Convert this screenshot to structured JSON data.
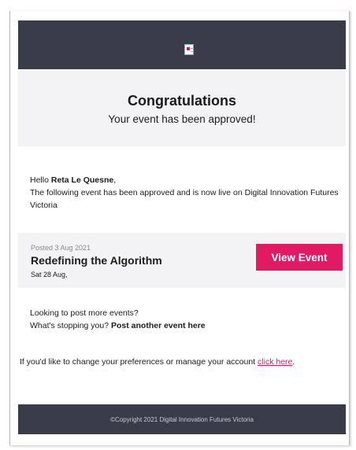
{
  "hero": {
    "title": "Congratulations",
    "subtitle": "Your event has been approved!"
  },
  "greeting": {
    "hello": "Hello",
    "name": "Reta Le Quesne",
    "message": "The following event has been approved and is now live on Digital Innovation Futures Victoria"
  },
  "event": {
    "posted": "Posted 3 Aug 2021",
    "title": "Redefining the Algorithm",
    "date": "Sat 28 Aug,",
    "button_label": "View Event"
  },
  "more": {
    "line1": "Looking to post more events?",
    "line2_prefix": "What's stopping you?",
    "line2_link": "Post another event here"
  },
  "preferences": {
    "text": "If you'd like to change your preferences or manage your account",
    "link": "click here"
  },
  "footer": {
    "copyright": "©Copyright 2021 Digital Innovation Futures Victoria"
  },
  "colors": {
    "accent": "#e01a63",
    "header_bg": "#383c49",
    "panel_bg": "#f3f3f5"
  }
}
